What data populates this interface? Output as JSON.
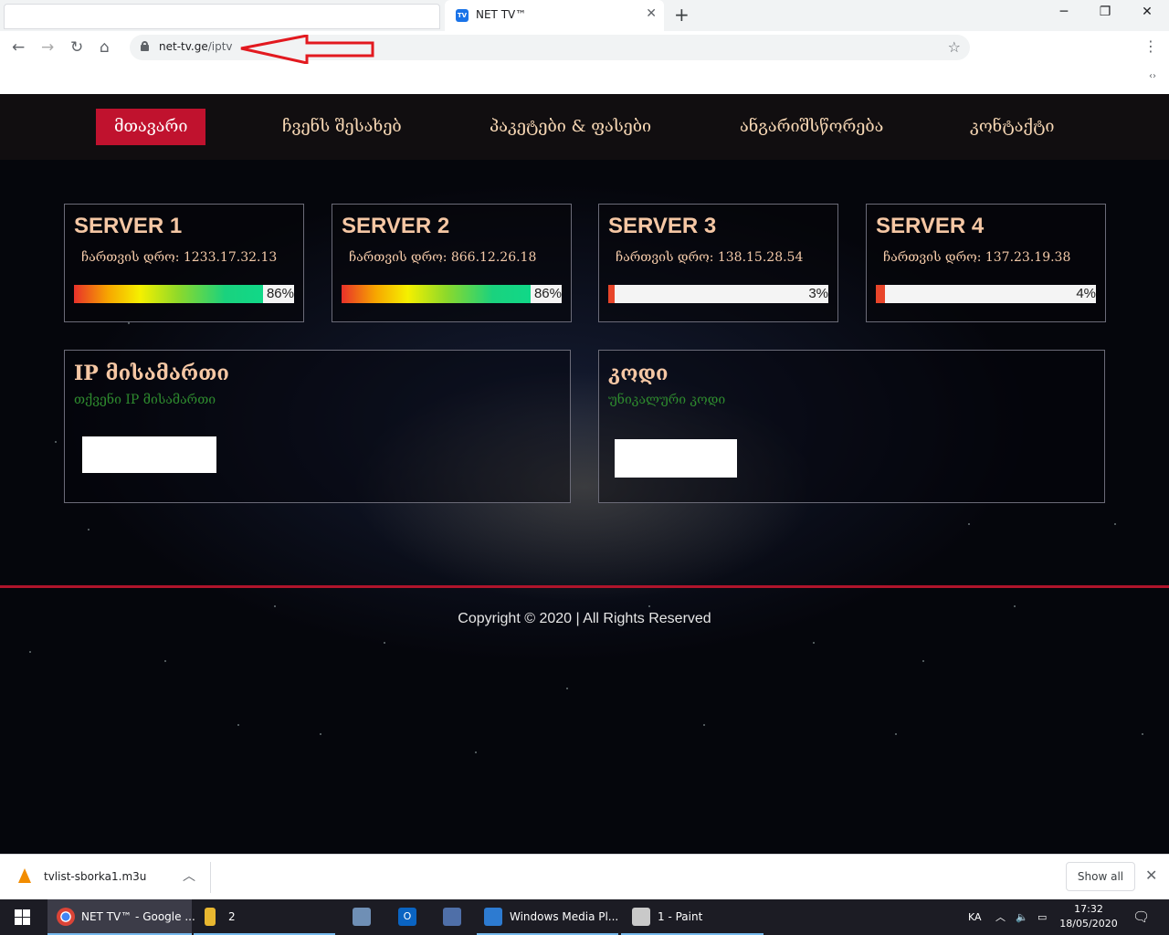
{
  "browser": {
    "tab_title": "NET TV™",
    "tab_favicon": "TV",
    "url_host": "net-tv.ge",
    "url_path": "/iptv",
    "nav_icons": [
      "back-icon",
      "forward-icon",
      "reload-icon",
      "home-icon"
    ]
  },
  "site": {
    "nav": [
      {
        "label": "მთავარი",
        "active": true
      },
      {
        "label": "ჩვენს შესახებ",
        "active": false
      },
      {
        "label": "პაკეტები & ფასები",
        "active": false
      },
      {
        "label": "ანგარიშსწორება",
        "active": false
      },
      {
        "label": "კონტაქტი",
        "active": false
      }
    ],
    "servers": [
      {
        "title": "SERVER 1",
        "uptime": "ჩართვის დრო: 1233.17.32.13",
        "load_text": "86%",
        "load": 86
      },
      {
        "title": "SERVER 2",
        "uptime": "ჩართვის დრო: 866.12.26.18",
        "load_text": "86%",
        "load": 86
      },
      {
        "title": "SERVER 3",
        "uptime": "ჩართვის დრო: 138.15.28.54",
        "load_text": "3%",
        "load": 3
      },
      {
        "title": "SERVER 4",
        "uptime": "ჩართვის დრო: 137.23.19.38",
        "load_text": "4%",
        "load": 4
      }
    ],
    "ip_box": {
      "title": "IP მისამართი",
      "subtitle": "თქვენი IP მისამართი"
    },
    "code_box": {
      "title": "კოდი",
      "subtitle": "უნიკალური კოდი"
    },
    "copyright": "Copyright © 2020 | All Rights Reserved",
    "colors": {
      "accent": "#c0122e",
      "heading": "#f5c7a4",
      "subtitle_green": "#2e8a2e"
    }
  },
  "downloads": {
    "file_name": "tvlist-sborka1.m3u",
    "show_all": "Show all"
  },
  "taskbar": {
    "items": [
      {
        "label": "NET TV™ - Google ...",
        "icon": "chrome-icon"
      },
      {
        "label": "2",
        "icon": "folder-icon"
      },
      {
        "label": "",
        "icon": "network-icon"
      },
      {
        "label": "",
        "icon": "outlook-icon"
      },
      {
        "label": "",
        "icon": "computer-icon"
      },
      {
        "label": "Windows Media Pl...",
        "icon": "media-player-icon"
      },
      {
        "label": "1 - Paint",
        "icon": "paint-icon"
      }
    ],
    "language": "KA",
    "time": "17:32",
    "date": "18/05/2020"
  }
}
